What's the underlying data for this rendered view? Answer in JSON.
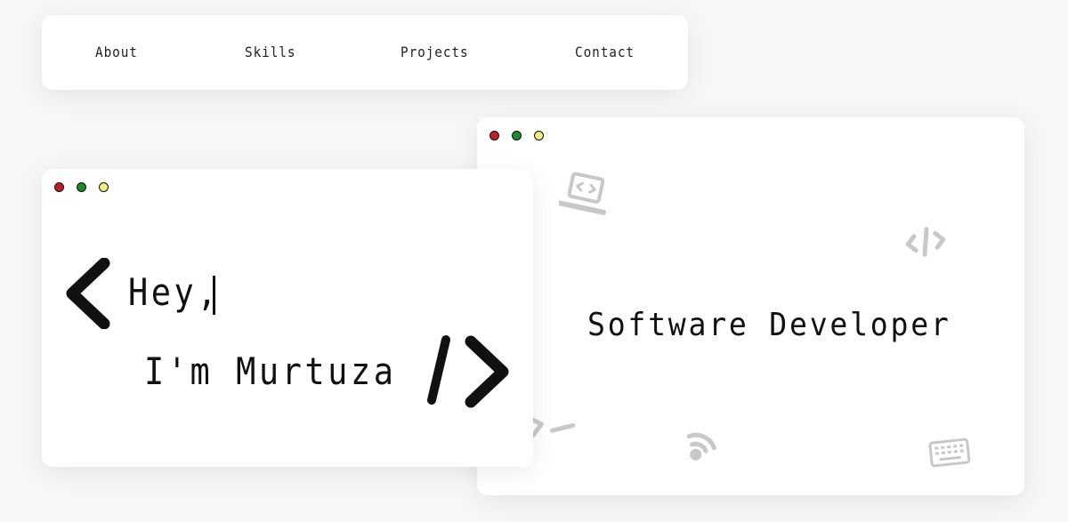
{
  "nav": {
    "items": [
      {
        "label": "About"
      },
      {
        "label": "Skills"
      },
      {
        "label": "Projects"
      },
      {
        "label": "Contact"
      }
    ]
  },
  "hero": {
    "greeting": "Hey,",
    "name": "I'm Murtuza"
  },
  "role_window": {
    "title": "Software Developer"
  },
  "icons": {
    "open_bracket": "chevron-left-icon",
    "close_tag": "slash-chevron-right-icon",
    "decor": [
      "laptop-code-icon",
      "code-tag-icon",
      "terminal-icon",
      "wifi-signal-icon",
      "keyboard-icon"
    ]
  },
  "colors": {
    "dot_red": "#c21f1f",
    "dot_green": "#1f8a2b",
    "dot_yellow": "#f2ec7c",
    "decor_gray": "#c8c8c8"
  }
}
